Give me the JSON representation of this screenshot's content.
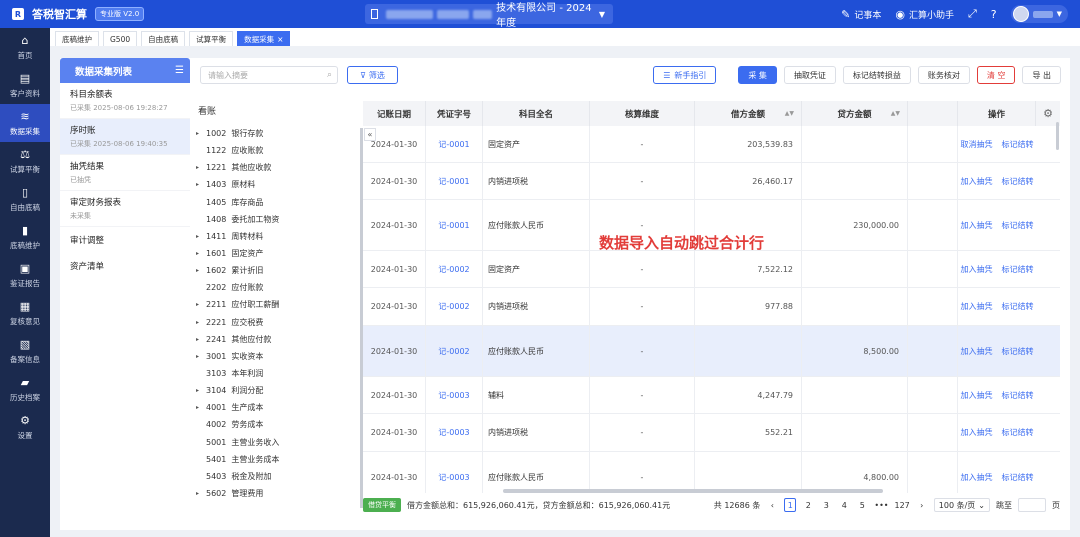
{
  "app": {
    "title": "答税智汇算",
    "version": "专业版 V2.0"
  },
  "header": {
    "company_suffix": "技术有限公司 - 2024年度",
    "notepad": "记事本",
    "assistant": "汇算小助手"
  },
  "sidebar": {
    "items": [
      {
        "label": "首页",
        "icon": "home-icon"
      },
      {
        "label": "客户资料",
        "icon": "id-card-icon"
      },
      {
        "label": "数据采集",
        "icon": "database-icon"
      },
      {
        "label": "试算平衡",
        "icon": "scale-icon"
      },
      {
        "label": "自由底稿",
        "icon": "document-icon"
      },
      {
        "label": "底稿维护",
        "icon": "book-icon"
      },
      {
        "label": "鉴证报告",
        "icon": "report-icon"
      },
      {
        "label": "复核意见",
        "icon": "review-icon"
      },
      {
        "label": "备案信息",
        "icon": "record-icon"
      },
      {
        "label": "历史档案",
        "icon": "folder-icon"
      },
      {
        "label": "设置",
        "icon": "gear-icon"
      }
    ]
  },
  "tabs": [
    {
      "label": "底稿维护"
    },
    {
      "label": "G500"
    },
    {
      "label": "自由底稿"
    },
    {
      "label": "试算平衡"
    },
    {
      "label": "数据采集"
    }
  ],
  "left_panel": {
    "title": "数据采集列表",
    "items": [
      {
        "name": "科目余额表",
        "sub": "已采集   2025-08-06 19:28:27"
      },
      {
        "name": "序时账",
        "sub": "已采集   2025-08-06 19:40:35"
      },
      {
        "name": "抽凭结果",
        "sub": "已抽凭"
      },
      {
        "name": "审定财务报表",
        "sub": "未采集"
      }
    ],
    "simple_items": [
      {
        "name": "审计调整"
      },
      {
        "name": "资产清单"
      }
    ]
  },
  "toolbar": {
    "search_placeholder": "请输入摘要",
    "filter": "筛选",
    "guide": "新手指引",
    "collect": "采 集",
    "extract": "抽取凭证",
    "mark_carry": "标记结转损益",
    "reconcile": "账务核对",
    "clear": "清 空",
    "export": "导 出"
  },
  "ledger": {
    "title": "看账",
    "accounts": [
      {
        "code": "1002",
        "name": "银行存款",
        "arrow": "▸"
      },
      {
        "code": "1122",
        "name": "应收账款",
        "arrow": ""
      },
      {
        "code": "1221",
        "name": "其他应收款",
        "arrow": "▸"
      },
      {
        "code": "1403",
        "name": "原材料",
        "arrow": "▸"
      },
      {
        "code": "1405",
        "name": "库存商品",
        "arrow": ""
      },
      {
        "code": "1408",
        "name": "委托加工物资",
        "arrow": ""
      },
      {
        "code": "1411",
        "name": "周转材料",
        "arrow": "▸"
      },
      {
        "code": "1601",
        "name": "固定资产",
        "arrow": "▸"
      },
      {
        "code": "1602",
        "name": "累计折旧",
        "arrow": "▸"
      },
      {
        "code": "2202",
        "name": "应付账款",
        "arrow": ""
      },
      {
        "code": "2211",
        "name": "应付职工薪酬",
        "arrow": "▸"
      },
      {
        "code": "2221",
        "name": "应交税费",
        "arrow": "▸"
      },
      {
        "code": "2241",
        "name": "其他应付款",
        "arrow": "▸"
      },
      {
        "code": "3001",
        "name": "实收资本",
        "arrow": "▸"
      },
      {
        "code": "3103",
        "name": "本年利润",
        "arrow": ""
      },
      {
        "code": "3104",
        "name": "利润分配",
        "arrow": "▸"
      },
      {
        "code": "4001",
        "name": "生产成本",
        "arrow": "▸"
      },
      {
        "code": "4002",
        "name": "劳务成本",
        "arrow": ""
      },
      {
        "code": "5001",
        "name": "主营业务收入",
        "arrow": ""
      },
      {
        "code": "5401",
        "name": "主营业务成本",
        "arrow": ""
      },
      {
        "code": "5403",
        "name": "税金及附加",
        "arrow": ""
      },
      {
        "code": "5602",
        "name": "管理费用",
        "arrow": "▸"
      }
    ]
  },
  "table": {
    "headers": [
      "记账日期",
      "凭证字号",
      "科目全名",
      "核算维度",
      "借方金额",
      "贷方金额",
      "",
      "操作"
    ],
    "rows": [
      {
        "date": "2024-01-30",
        "voucher": "记-0001",
        "subject": "固定资产",
        "dim": "-",
        "debit": "203,539.83",
        "credit": "",
        "op1": "取消抽凭",
        "op2": "标记结转"
      },
      {
        "date": "2024-01-30",
        "voucher": "记-0001",
        "subject": "内销进项税",
        "dim": "-",
        "debit": "26,460.17",
        "credit": "",
        "op1": "加入抽凭",
        "op2": "标记结转"
      },
      {
        "date": "2024-01-30",
        "voucher": "记-0001",
        "subject": "应付账款人民币",
        "dim": "-",
        "debit": "",
        "credit": "230,000.00",
        "op1": "加入抽凭",
        "op2": "标记结转"
      },
      {
        "date": "2024-01-30",
        "voucher": "记-0002",
        "subject": "固定资产",
        "dim": "-",
        "debit": "7,522.12",
        "credit": "",
        "op1": "加入抽凭",
        "op2": "标记结转"
      },
      {
        "date": "2024-01-30",
        "voucher": "记-0002",
        "subject": "内销进项税",
        "dim": "-",
        "debit": "977.88",
        "credit": "",
        "op1": "加入抽凭",
        "op2": "标记结转"
      },
      {
        "date": "2024-01-30",
        "voucher": "记-0002",
        "subject": "应付账款人民币",
        "dim": "-",
        "debit": "",
        "credit": "8,500.00",
        "op1": "加入抽凭",
        "op2": "标记结转"
      },
      {
        "date": "2024-01-30",
        "voucher": "记-0003",
        "subject": "辅料",
        "dim": "-",
        "debit": "4,247.79",
        "credit": "",
        "op1": "加入抽凭",
        "op2": "标记结转"
      },
      {
        "date": "2024-01-30",
        "voucher": "记-0003",
        "subject": "内销进项税",
        "dim": "-",
        "debit": "552.21",
        "credit": "",
        "op1": "加入抽凭",
        "op2": "标记结转"
      },
      {
        "date": "2024-01-30",
        "voucher": "记-0003",
        "subject": "应付账款人民币",
        "dim": "-",
        "debit": "",
        "credit": "4,800.00",
        "op1": "加入抽凭",
        "op2": "标记结转"
      }
    ]
  },
  "annotation": "数据导入自动跳过合计行",
  "footer": {
    "badge": "借贷平衡",
    "summary": "借方金额总和：615,926,060.41元，贷方金额总和：615,926,060.41元",
    "total": "共 12686 条",
    "pages": [
      "1",
      "2",
      "3",
      "4",
      "5",
      "•••",
      "127"
    ],
    "page_size": "100 条/页",
    "jump": "跳至",
    "page_unit": "页"
  }
}
